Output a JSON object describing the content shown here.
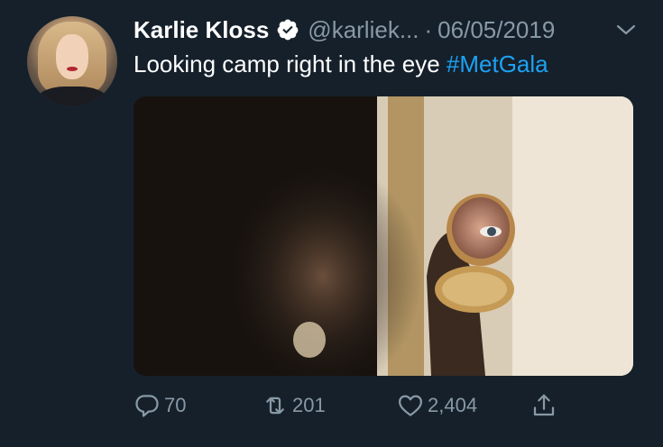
{
  "tweet": {
    "author_name": "Karlie Kloss",
    "handle": "@karliek...",
    "separator": "·",
    "date": "06/05/2019",
    "text": "Looking camp right in the eye",
    "hashtag": "#MetGala",
    "verified": true
  },
  "actions": {
    "replies": "70",
    "retweets": "201",
    "likes": "2,404"
  },
  "icons": {
    "verified": "verified-badge-icon",
    "menu": "chevron-down-icon",
    "reply": "reply-icon",
    "retweet": "retweet-icon",
    "like": "heart-icon",
    "share": "share-icon"
  },
  "colors": {
    "background": "#15202b",
    "text": "#ffffff",
    "muted": "#8899a6",
    "link": "#1da1f2"
  }
}
